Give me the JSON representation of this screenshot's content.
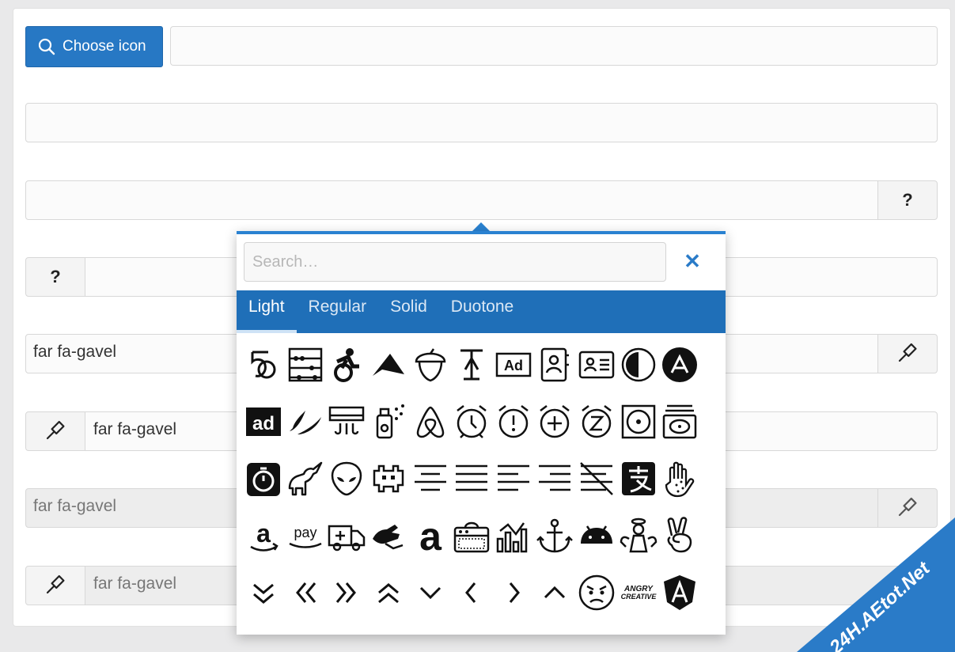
{
  "choose_button": {
    "label": "Choose icon"
  },
  "addons": {
    "question": "?"
  },
  "fields": {
    "row5_value": "far fa-gavel",
    "row6_value": "far fa-gavel",
    "row7_value": "far fa-gavel",
    "row8_value": "far fa-gavel"
  },
  "popover": {
    "search_placeholder": "Search…",
    "close_symbol": "✕",
    "tabs": [
      "Light",
      "Regular",
      "Solid",
      "Duotone"
    ],
    "active_tab": "Light",
    "icons": [
      [
        "500px-icon",
        "abacus-icon",
        "accessible-icon-icon",
        "accusoft-icon",
        "acorn-icon",
        "acquisitions-incorporated-icon",
        "ad-icon",
        "address-book-icon",
        "address-card-icon",
        "adjust-icon",
        "adn-icon"
      ],
      [
        "adversal-icon",
        "affiliatetheme-icon",
        "air-conditioner-icon",
        "air-freshener-icon",
        "airbnb-icon",
        "alarm-clock-icon",
        "alarm-exclamation-icon",
        "alarm-plus-icon",
        "alarm-snooze-icon",
        "album-icon",
        "album-collection-icon"
      ],
      [
        "alarm-timer-icon",
        "alicorn-icon",
        "alien-icon",
        "alien-monster-icon",
        "align-center-icon",
        "align-justify-icon",
        "align-left-icon",
        "align-right-icon",
        "align-slash-icon",
        "alipay-icon",
        "allergies-icon"
      ],
      [
        "amazon-icon",
        "amazon-pay-icon",
        "ambulance-icon",
        "american-sign-language-interpreting-icon",
        "amilia-icon",
        "amp-guitar-icon",
        "analytics-icon",
        "anchor-icon",
        "android-icon",
        "angel-icon",
        "angellist-icon"
      ],
      [
        "angle-double-down-icon",
        "angle-double-left-icon",
        "angle-double-right-icon",
        "angle-double-up-icon",
        "angle-down-icon",
        "angle-left-icon",
        "angle-right-icon",
        "angle-up-icon",
        "angry-icon",
        "angrycreative-icon",
        "angular-icon"
      ]
    ],
    "angry_creative_text": "ANGRY CREATIVE",
    "ad_text": "Ad",
    "adversal_text": "ad",
    "pay_text": "pay"
  },
  "watermark": {
    "text": "24H.AEtot.Net",
    "color": "#2a7bc8"
  }
}
